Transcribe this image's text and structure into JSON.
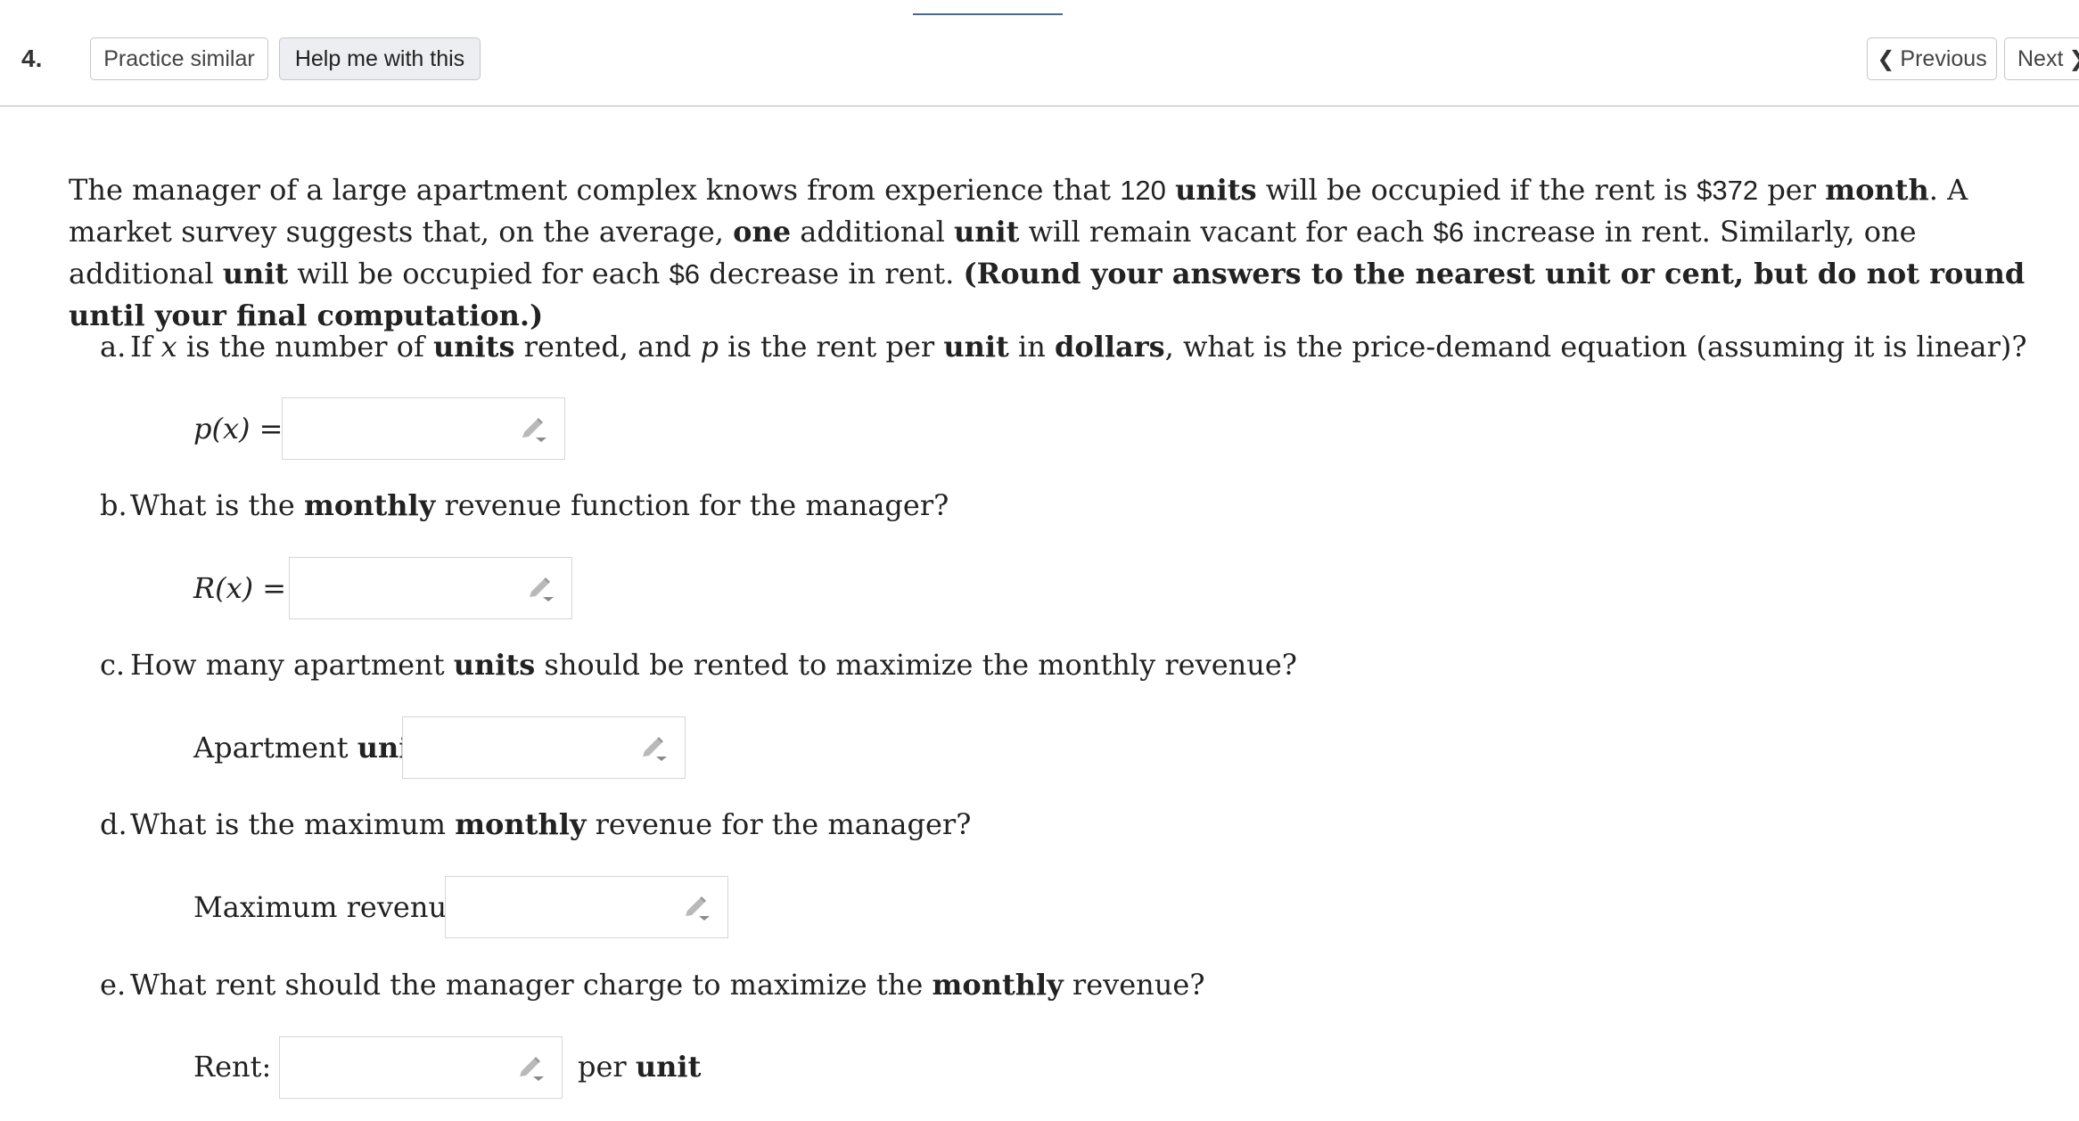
{
  "toolbar": {
    "question_number": "4.",
    "practice_label": "Practice similar",
    "help_label": "Help me with this",
    "previous_label": "Previous",
    "next_label": "Next"
  },
  "problem": {
    "intro_part1": "The manager of a large apartment complex knows from experience that ",
    "units_count": "120",
    "units_word": "units",
    "intro_part2": " will be occupied if the rent is ",
    "rent_amount": "$372",
    "intro_part3": " per ",
    "month_word": "month",
    "intro_part4": ". A market survey suggests that, on the average, ",
    "one_word": "one",
    "intro_part5": " additional ",
    "unit_word": "unit",
    "intro_part6": " will remain vacant for each ",
    "increase_amount": "$6",
    "intro_part7": " increase in rent. Similarly, one additional ",
    "unit_word_2": "unit",
    "intro_part8": " will be occupied for each ",
    "decrease_amount": "$6",
    "intro_part9": " decrease in rent. ",
    "rounding_note": "(Round your answers to the nearest unit or cent, but do not round until your final computation.)"
  },
  "parts": {
    "a": {
      "letter": "a.",
      "q_part1": "If ",
      "var_x": "x",
      "q_part2": " is the number of ",
      "units_word": "units",
      "q_part3": " rented, and ",
      "var_p": "p",
      "q_part4": " is the rent per ",
      "unit_word": "unit",
      "q_part5": " in ",
      "dollars_word": "dollars",
      "q_part6": ", what is the price-demand equation (assuming it is linear)?",
      "answer_label": "p(x) =",
      "answer_value": ""
    },
    "b": {
      "letter": "b.",
      "q_part1": "What is the ",
      "monthly_word": "monthly",
      "q_part2": " revenue function for the manager?",
      "answer_label": "R(x) =",
      "answer_value": ""
    },
    "c": {
      "letter": "c.",
      "q_part1": "How many apartment ",
      "units_word": "units",
      "q_part2": " should be rented to maximize the monthly revenue?",
      "answer_label_1": "Apartment ",
      "answer_label_2": "units",
      "answer_label_3": ":",
      "answer_value": ""
    },
    "d": {
      "letter": "d.",
      "q_part1": "What is the maximum ",
      "monthly_word": "monthly",
      "q_part2": " revenue for the manager?",
      "answer_label_1": "Maximum revenue: ",
      "answer_label_2": "$",
      "answer_value": ""
    },
    "e": {
      "letter": "e.",
      "q_part1": "What rent should the manager charge to maximize the ",
      "monthly_word": "monthly",
      "q_part2": " revenue?",
      "answer_label_1": "Rent: ",
      "answer_label_2": "$",
      "after_label_1": "per ",
      "after_label_2": "unit",
      "answer_value": ""
    }
  },
  "icons": {
    "input_tool": "pencil-icon"
  }
}
